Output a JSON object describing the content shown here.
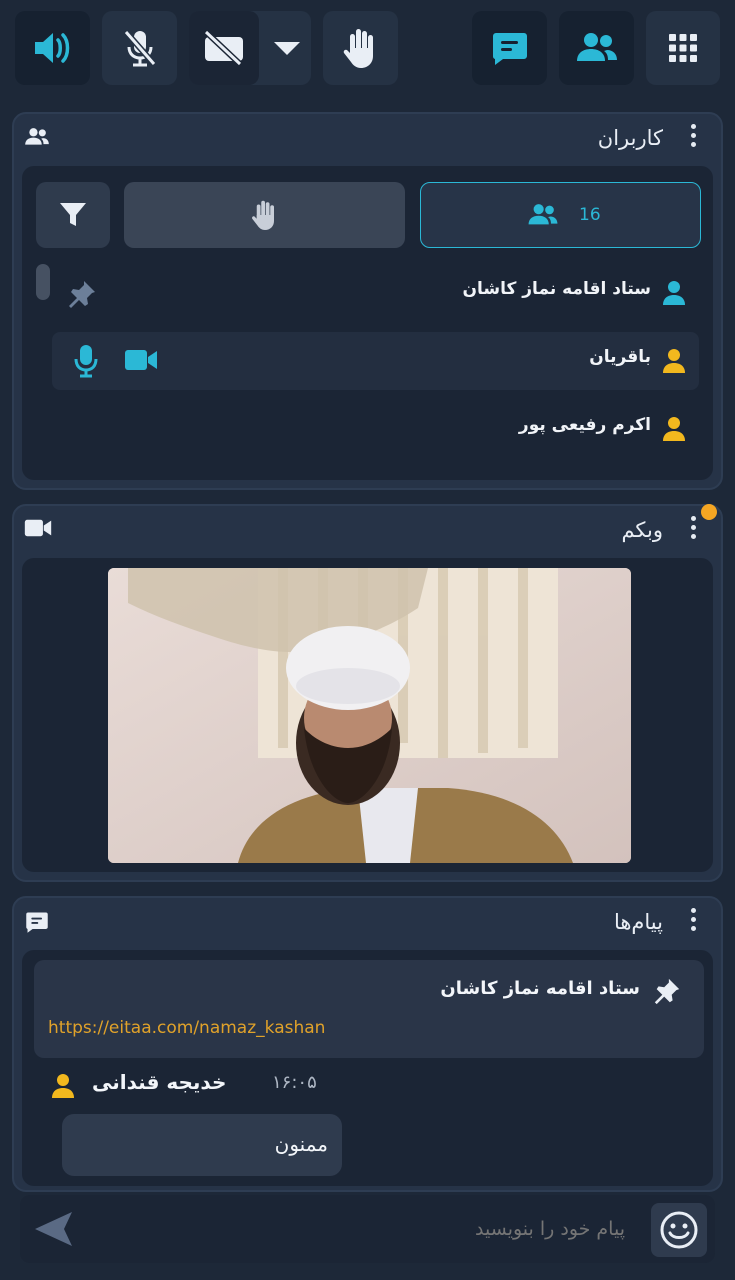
{
  "toolbar": {
    "speaker": "speaker-icon",
    "mic": "mic-off-icon",
    "camera": "camera-off-icon",
    "dropdown": "caret-down-icon",
    "hand": "raise-hand-icon",
    "chat": "chat-icon",
    "users": "users-icon",
    "apps": "grid-icon"
  },
  "users_panel": {
    "title": "کاربران",
    "count": "16",
    "users": [
      {
        "name": "ستاد اقامه نماز کاشان",
        "icon_color": "#2bb8d6",
        "pinned": true,
        "mic": false,
        "cam": false
      },
      {
        "name": "باقریان",
        "icon_color": "#f2b81e",
        "pinned": false,
        "mic": true,
        "cam": true
      },
      {
        "name": "اکرم رفیعی پور",
        "icon_color": "#f2b81e",
        "pinned": false,
        "mic": false,
        "cam": false
      }
    ]
  },
  "webcam_panel": {
    "title": "وبکم"
  },
  "messages_panel": {
    "title": "پیام‌ها",
    "pinned": {
      "sender": "ستاد اقامه نماز کاشان",
      "text": "https://eitaa.com/namaz_kashan"
    },
    "message": {
      "sender": "خدیجه قندانی",
      "time": "۱۶:۰۵",
      "text": "ممنون"
    },
    "input_placeholder": "پیام خود را بنویسید"
  },
  "colors": {
    "accent": "#2bb8d6",
    "user_yellow": "#f2b81e",
    "link": "#e0a22a",
    "notify": "#f5a623"
  }
}
